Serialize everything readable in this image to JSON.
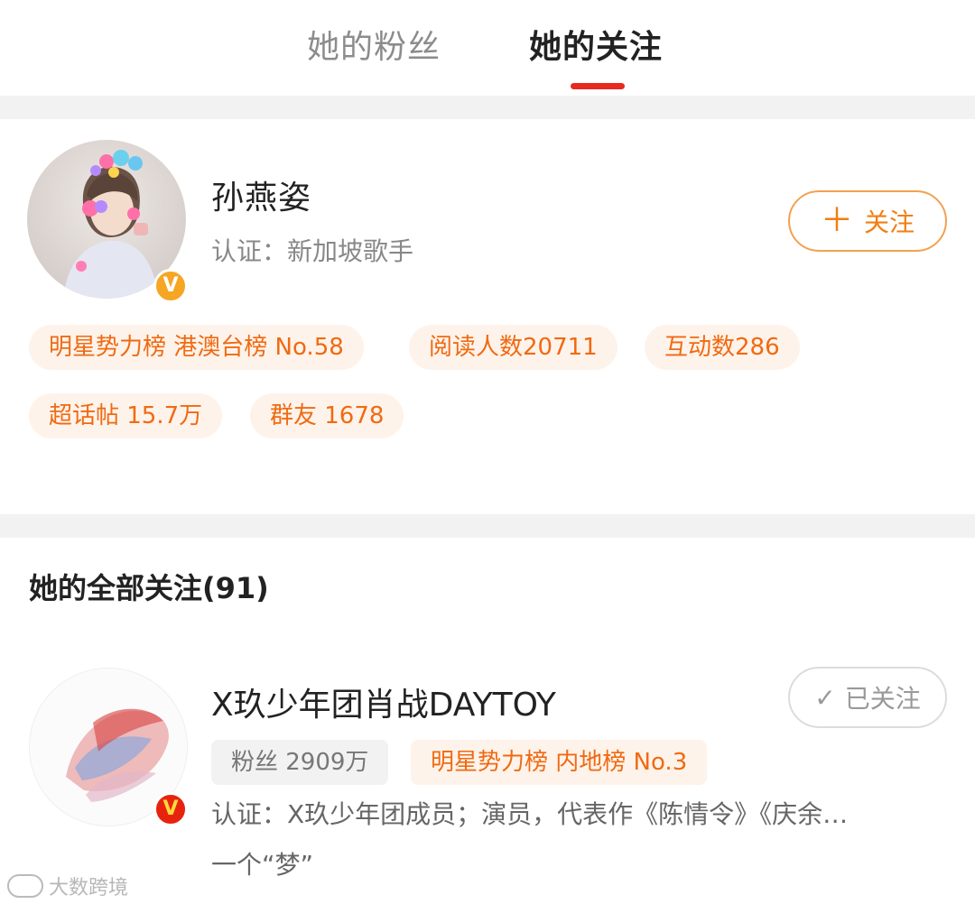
{
  "tabs": [
    {
      "label": "她的粉丝",
      "active": false
    },
    {
      "label": "她的关注",
      "active": true
    }
  ],
  "accent_color": "#e8291f",
  "profile": {
    "name": "孙燕姿",
    "verification": "认证：新加坡歌手",
    "badge": "V",
    "follow_label": "关注",
    "follow_icon": "plus-icon",
    "chips": [
      "明星势力榜 港澳台榜 No.58",
      "阅读人数20711",
      "互动数286",
      "超话帖 15.7万",
      "群友 1678"
    ]
  },
  "following": {
    "title": "她的全部关注(91)",
    "items": [
      {
        "name": "X玖少年团肖战DAYTOY",
        "followed_label": "已关注",
        "followed_icon": "check-icon",
        "badge": "V",
        "chips": [
          "粉丝 2909万",
          "明星势力榜 内地榜 No.3"
        ],
        "verification": "认证：X玖少年团成员；演员，代表作《陈情令》《庆余…",
        "bio": "一个“梦”"
      }
    ]
  },
  "watermark": "大数跨境"
}
